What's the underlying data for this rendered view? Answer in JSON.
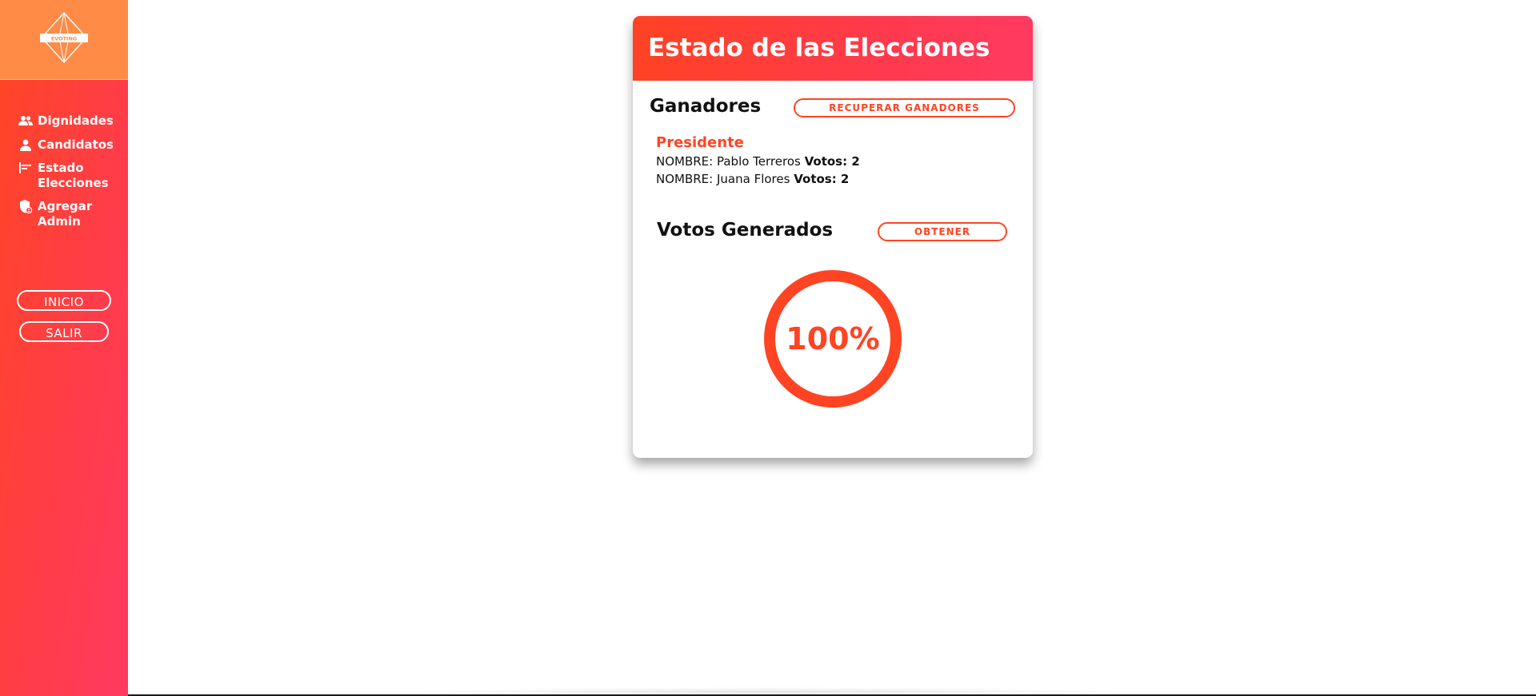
{
  "brand": {
    "logo_text": "EVOTING"
  },
  "colors": {
    "accent": "#ff4424",
    "sidebar_gradient_start": "#ff4524",
    "sidebar_gradient_end": "#ff3a60",
    "logo_background": "#ff8b47"
  },
  "sidebar": {
    "items": [
      {
        "label": "Dignidades",
        "icon": "users-icon"
      },
      {
        "label": "Candidatos",
        "icon": "user-icon"
      },
      {
        "label": "Estado Elecciones",
        "icon": "bar-chart-icon"
      },
      {
        "label": "Agregar Admin",
        "icon": "shield-user-icon"
      }
    ],
    "inicio_label": "INICIO",
    "salir_label": "SALIR"
  },
  "card": {
    "title": "Estado de las Elecciones",
    "winners": {
      "title": "Ganadores",
      "button_label": "RECUPERAR GANADORES",
      "dignity": "Presidente",
      "rows": [
        {
          "name_prefix": "NOMBRE: Pablo Terreros",
          "votes": "Votos: 2"
        },
        {
          "name_prefix": "NOMBRE: Juana Flores",
          "votes": "Votos: 2"
        }
      ]
    },
    "votes": {
      "title": "Votos Generados",
      "button_label": "OBTENER",
      "progress_text": "100%",
      "progress_value": 100
    }
  }
}
